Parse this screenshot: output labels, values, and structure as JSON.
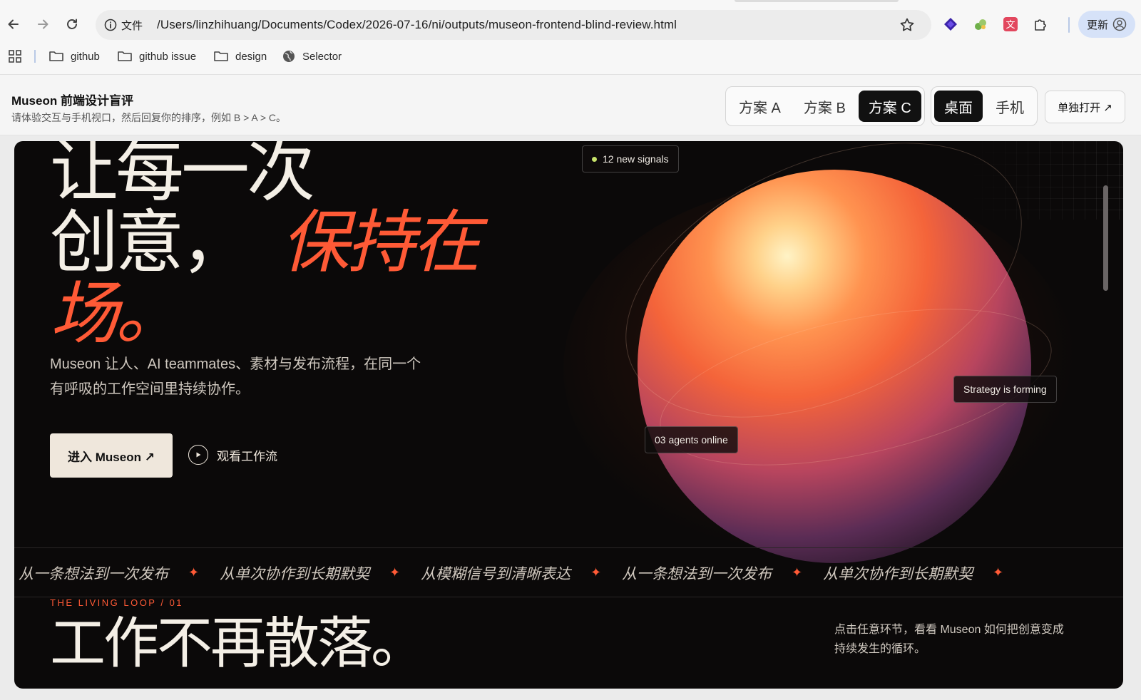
{
  "browser": {
    "site_info_label": "文件",
    "url": "/Users/linzhihuang/Documents/Codex/2026-07-16/ni/outputs/museon-frontend-blind-review.html",
    "update_label": "更新",
    "bookmarks": [
      {
        "label": "github",
        "icon": "folder-icon"
      },
      {
        "label": "github issue",
        "icon": "folder-icon"
      },
      {
        "label": "design",
        "icon": "folder-icon"
      },
      {
        "label": "Selector",
        "icon": "globe-icon"
      }
    ]
  },
  "review": {
    "title": "Museon 前端设计盲评",
    "subtitle": "请体验交互与手机视口，然后回复你的排序，例如 B > A > C。",
    "variants": [
      "方案 A",
      "方案 B",
      "方案 C"
    ],
    "selected_variant": "方案 C",
    "viewports": [
      "桌面",
      "手机"
    ],
    "selected_viewport": "桌面",
    "open_label": "单独打开 ↗"
  },
  "preview": {
    "hero_line1": "让每一次",
    "hero_line2": "创意，",
    "hero_accent1": "保持在",
    "hero_accent2": "场。",
    "hero_desc": "Museon 让人、AI teammates、素材与发布流程，在同一个有呼吸的工作空间里持续协作。",
    "cta_label": "进入 Museon ↗",
    "watch_label": "观看工作流",
    "chip_signals": "12 new signals",
    "chip_strategy": "Strategy is forming",
    "chip_agents": "03 agents online",
    "marquee": [
      "从一条想法到一次发布",
      "从单次协作到长期默契",
      "从模糊信号到清晰表达",
      "从一条想法到一次发布",
      "从单次协作到长期默契"
    ],
    "marquee_separator": "✦",
    "loop_label": "THE LIVING LOOP / 01",
    "section_title": "工作不再散落。",
    "section_note": "点击任意环节，看看 Museon 如何把创意变成持续发生的循环。"
  },
  "colors": {
    "accent": "#ff5a36",
    "signal_dot": "#c7e36a",
    "canvas": "#0b0909",
    "cream": "#efe7dc"
  }
}
